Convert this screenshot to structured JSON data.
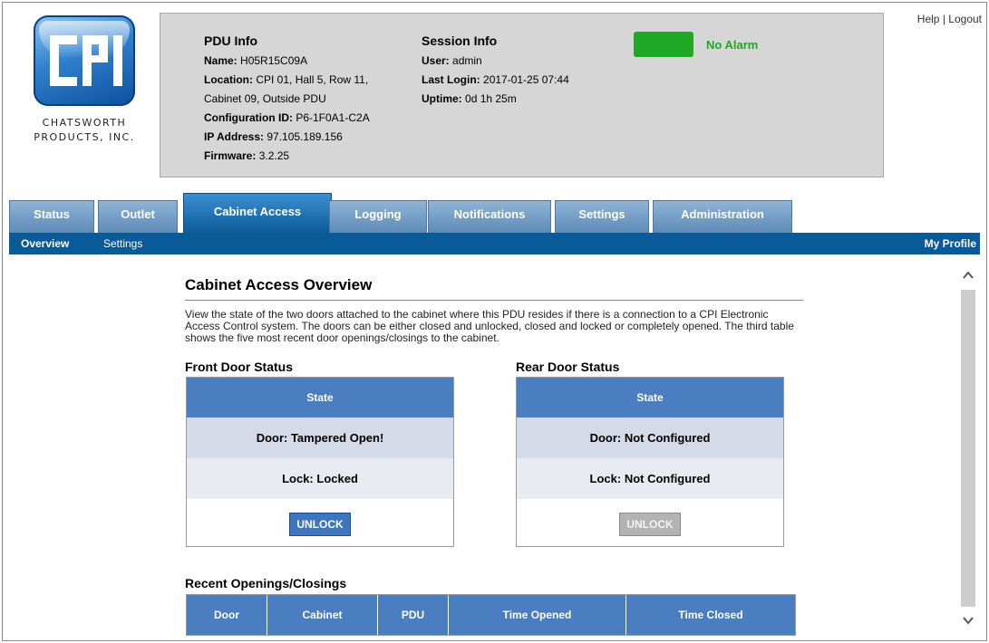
{
  "branding": {
    "logo_letters": "CPI",
    "company_line1": "CHATSWORTH",
    "company_line2": "PRODUCTS, INC."
  },
  "pdu_info": {
    "title": "PDU Info",
    "name_label": "Name:",
    "name_value": "H05R15C09A",
    "location_label": "Location:",
    "location_value_line1": "CPI 01, Hall 5, Row 11,",
    "location_value_line2": "Cabinet 09, Outside PDU",
    "config_label": "Configuration ID:",
    "config_value": "P6-1F0A1-C2A",
    "ip_label": "IP Address:",
    "ip_value": "97.105.189.156",
    "firmware_label": "Firmware:",
    "firmware_value": "3.2.25"
  },
  "session_info": {
    "title": "Session Info",
    "user_label": "User:",
    "user_value": "admin",
    "last_login_label": "Last Login:",
    "last_login_value": "2017-01-25 07:44",
    "uptime_label": "Uptime:",
    "uptime_value": "0d 1h 25m"
  },
  "alarm": {
    "text": "No Alarm",
    "color": "#1fa824"
  },
  "top_links": {
    "help": "Help",
    "separator": "|",
    "logout": "Logout"
  },
  "tabs": [
    {
      "label": "Status"
    },
    {
      "label": "Outlet"
    },
    {
      "label": "Cabinet Access",
      "active": true
    },
    {
      "label": "Logging"
    },
    {
      "label": "Notifications"
    },
    {
      "label": "Settings"
    },
    {
      "label": "Administration"
    }
  ],
  "subnav": {
    "overview": "Overview",
    "settings": "Settings",
    "my_profile": "My Profile"
  },
  "page": {
    "title": "Cabinet Access Overview",
    "description": "View the state of the two doors attached to the cabinet where this PDU resides if there is a connection to a CPI Electronic Access Control system. The doors can be either closed and unlocked, closed and locked or completely opened. The third table shows the five most recent door openings/closings to the cabinet."
  },
  "front_door": {
    "title": "Front Door Status",
    "header": "State",
    "door": "Door: Tampered Open!",
    "lock": "Lock: Locked",
    "button": "UNLOCK"
  },
  "rear_door": {
    "title": "Rear Door Status",
    "header": "State",
    "door": "Door: Not Configured",
    "lock": "Lock: Not Configured",
    "button": "UNLOCK"
  },
  "recent": {
    "title": "Recent Openings/Closings",
    "columns": [
      "Door",
      "Cabinet",
      "PDU",
      "Time Opened",
      "Time Closed"
    ]
  },
  "colors": {
    "accent": "#0a5a98",
    "table_header": "#4a7ec0",
    "panel": "#d6d6d6"
  }
}
